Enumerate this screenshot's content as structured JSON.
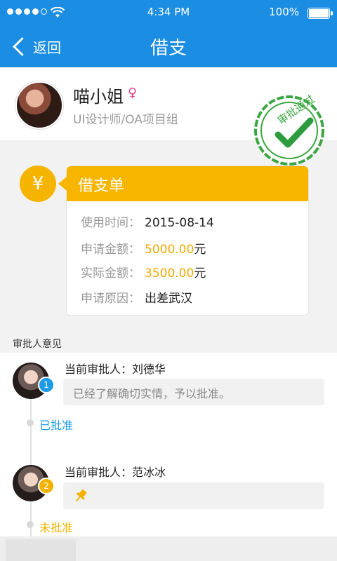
{
  "status_bar": {
    "time": "4:34 PM",
    "battery": "100%"
  },
  "nav": {
    "back_label": "返回",
    "title": "借支"
  },
  "profile": {
    "name": "喵小姐",
    "gender_symbol": "♀",
    "role": "UI设计师/OA项目组"
  },
  "stamp": {
    "text": "审批通过"
  },
  "card": {
    "icon": "¥",
    "title": "借支单",
    "rows": [
      {
        "label": "使用时间：",
        "value": "2015-08-14",
        "unit": ""
      },
      {
        "label": "申请金额：",
        "value": "5000.00",
        "unit": "元"
      },
      {
        "label": "实际金额：",
        "value": "3500.00",
        "unit": "元"
      },
      {
        "label": "申请原因：",
        "value": "出差武汉",
        "unit": ""
      }
    ]
  },
  "approvals_section": {
    "label": "审批人意见",
    "items": [
      {
        "index": "1",
        "approver": "当前审批人：刘德华",
        "comment": "已经了解确切实情，予以批准。",
        "status": "已批准"
      },
      {
        "index": "2",
        "approver": "当前审批人：范冰冰",
        "comment": "",
        "status": "未批准"
      }
    ]
  },
  "colors": {
    "nav": "#1b8de3",
    "accent": "#f7b500",
    "approved": "#1e9be6",
    "pending": "#f2b300",
    "stamp": "#3aa642"
  }
}
